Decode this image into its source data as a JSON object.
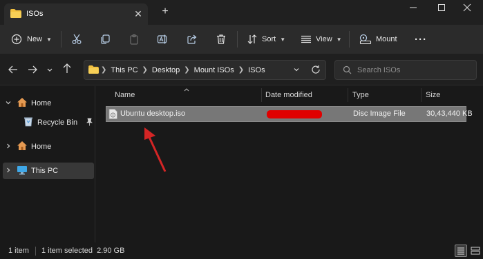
{
  "window": {
    "tab_title": "ISOs",
    "new_tab": "+",
    "tab_close": "✕"
  },
  "toolbar": {
    "new_label": "New",
    "sort_label": "Sort",
    "view_label": "View",
    "mount_label": "Mount",
    "more_label": "···"
  },
  "address": {
    "breadcrumbs": [
      "This PC",
      "Desktop",
      "Mount ISOs",
      "ISOs"
    ],
    "search_placeholder": "Search ISOs"
  },
  "sidebar": {
    "items": [
      {
        "label": "Home"
      },
      {
        "label": "Recycle Bin"
      },
      {
        "label": "Home"
      },
      {
        "label": "This PC"
      }
    ]
  },
  "columns": {
    "name": "Name",
    "date": "Date modified",
    "type": "Type",
    "size": "Size"
  },
  "files": [
    {
      "name": "Ubuntu desktop.iso",
      "type": "Disc Image File",
      "size": "30,43,440 KB"
    }
  ],
  "status": {
    "count": "1 item",
    "selected": "1 item selected  2.90 GB"
  },
  "colors": {
    "accent_arrow": "#d42525",
    "folder": "#f3c13f",
    "selection": "#777777"
  }
}
